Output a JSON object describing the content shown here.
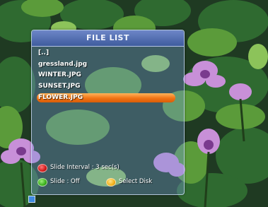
{
  "panel": {
    "title": "FILE LIST",
    "files": [
      "[..]",
      "gressland.jpg",
      "WINTER.JPG",
      "SUNSET.JPG",
      "FLOWER.JPG"
    ],
    "selected_index": 4
  },
  "legend": {
    "red": {
      "label": "Slide Interval : 3 sec(s)",
      "color": "#d01818"
    },
    "green": {
      "label": "Slide : Off",
      "color": "#3ab01c"
    },
    "yellow": {
      "label": "Select Disk",
      "color": "#f2b21a"
    }
  },
  "colors": {
    "highlight": "#f07314",
    "panel": "#6f8ccc"
  }
}
